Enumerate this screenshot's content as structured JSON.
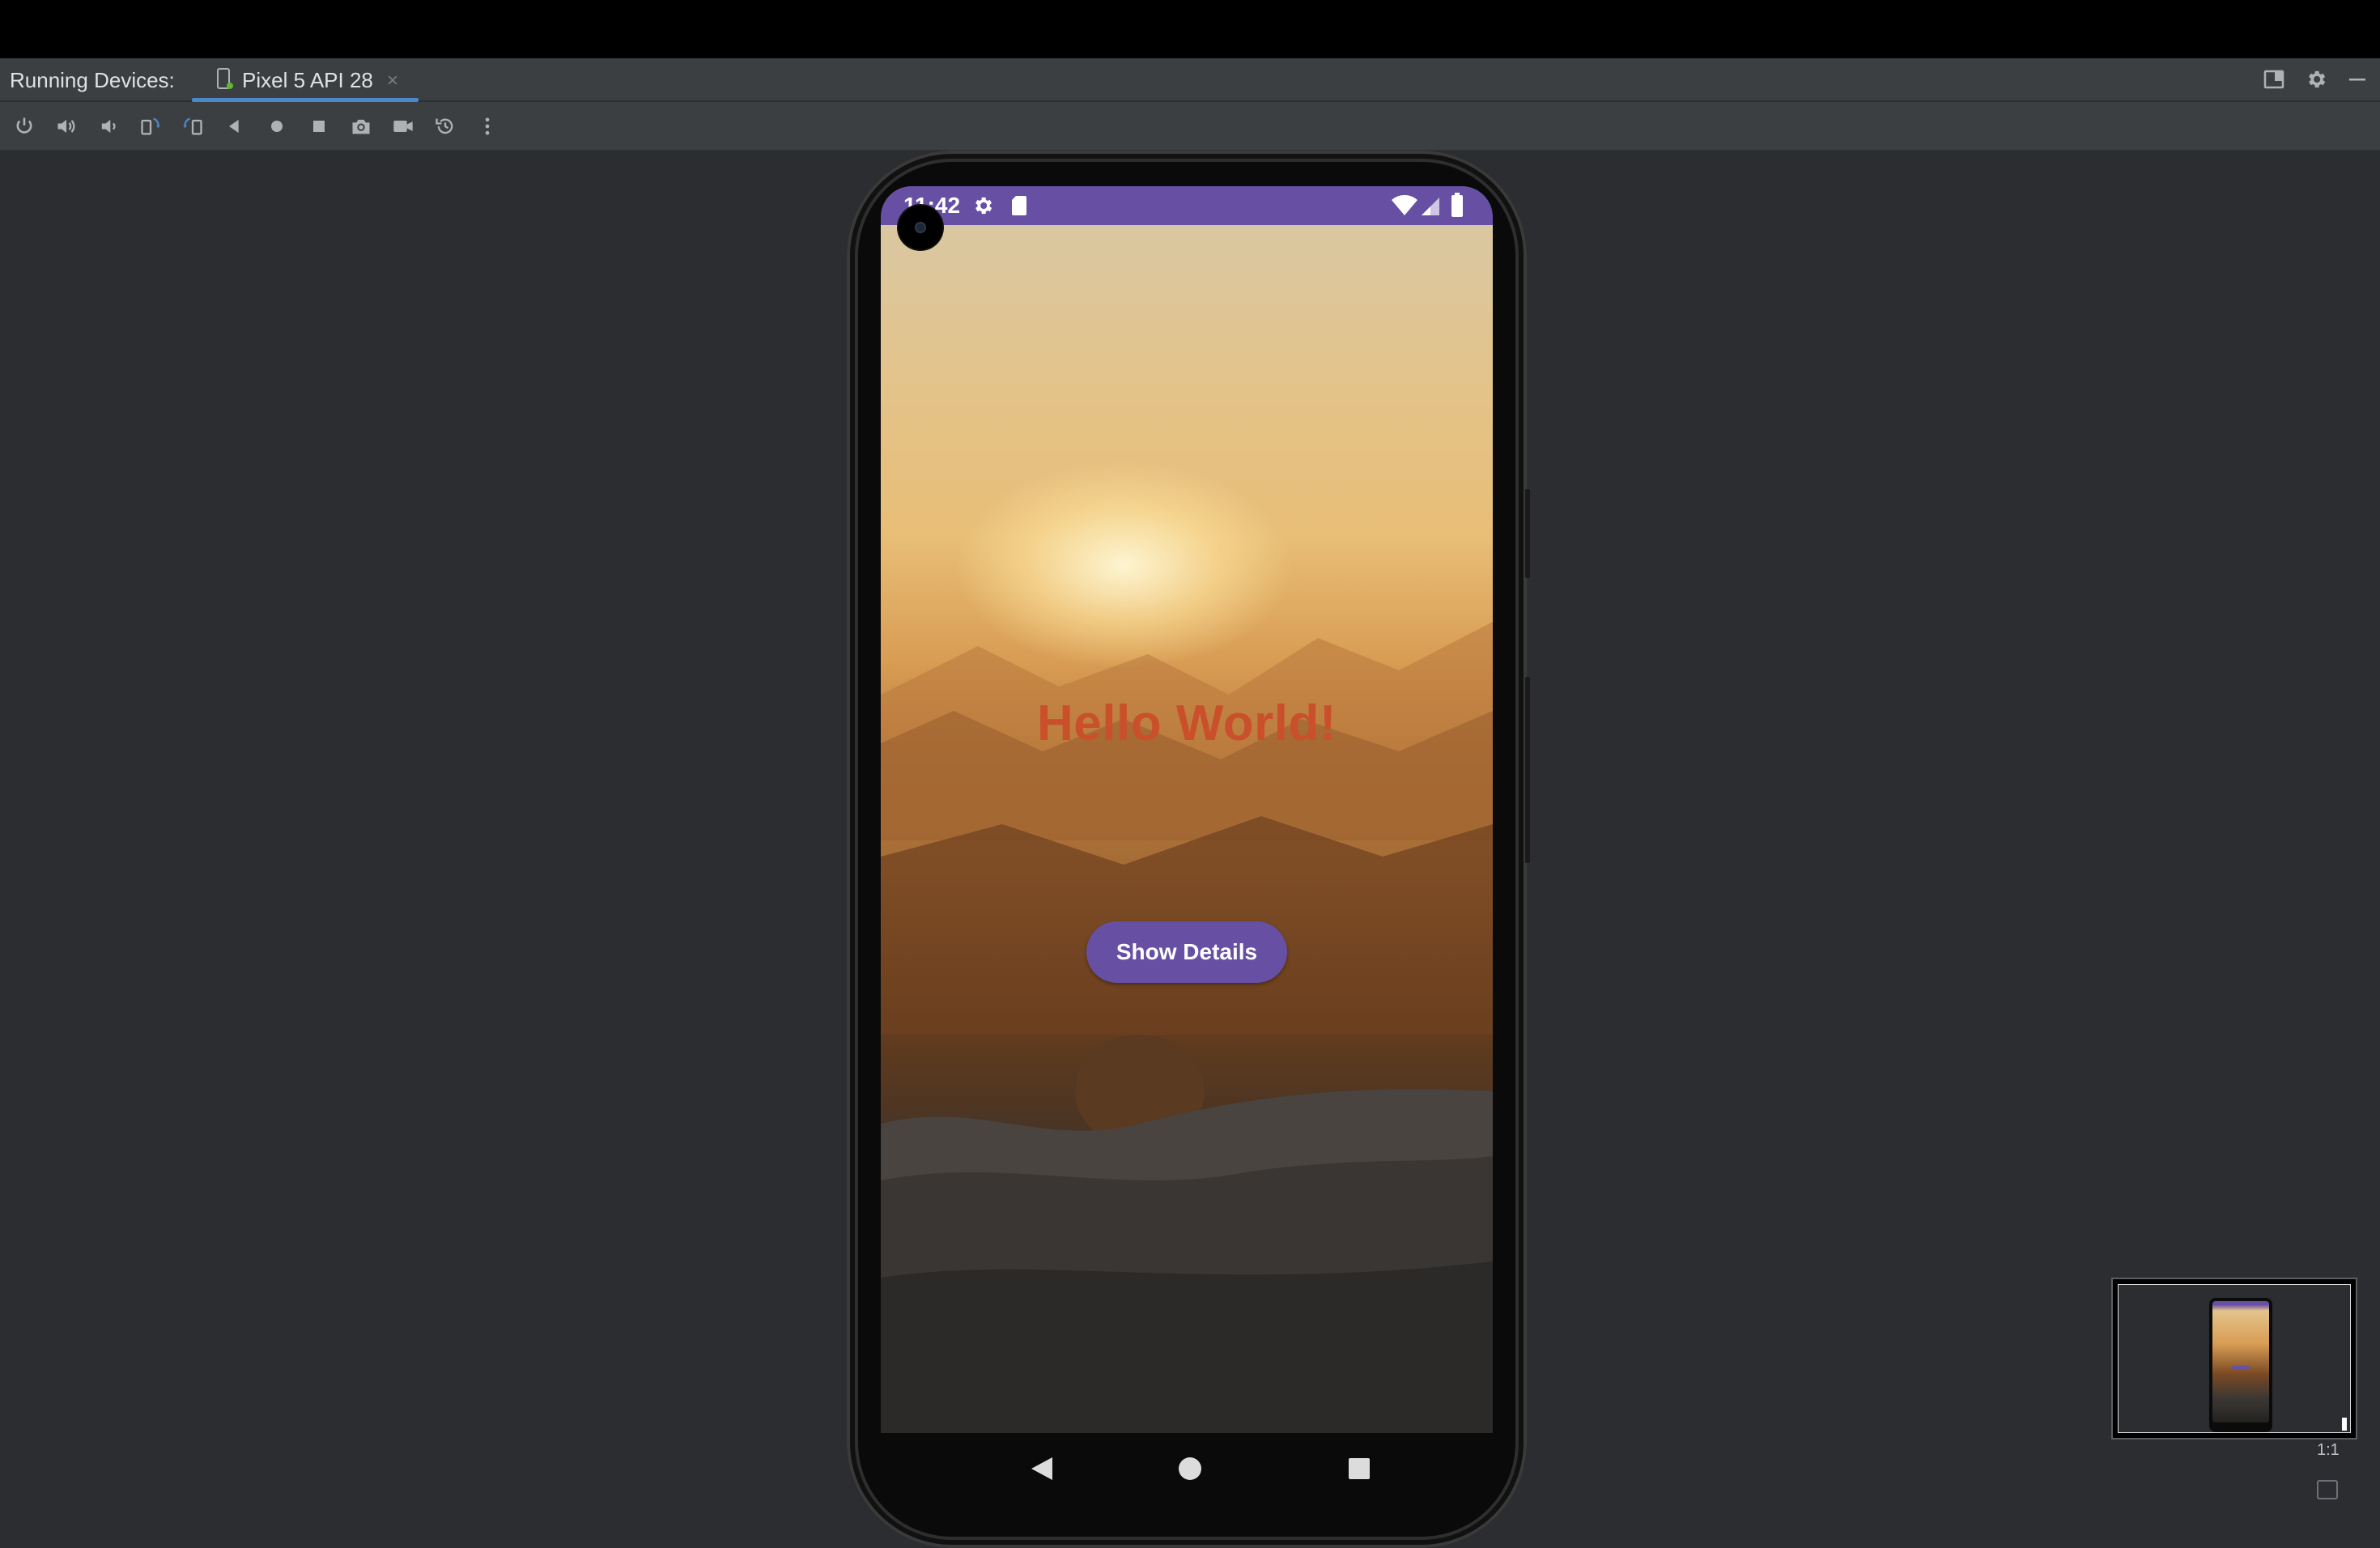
{
  "window": {
    "panel_label": "Running Devices:",
    "tab": {
      "label": "Pixel 5 API 28",
      "close": "×",
      "icon": "device-icon"
    },
    "right_icons": [
      "layout-icon",
      "gear-icon",
      "minimize-icon"
    ]
  },
  "toolbar": {
    "buttons": [
      {
        "name": "power-icon"
      },
      {
        "name": "volume-up-icon"
      },
      {
        "name": "volume-down-icon"
      },
      {
        "name": "rotate-left-icon"
      },
      {
        "name": "rotate-right-icon"
      },
      {
        "name": "back-icon"
      },
      {
        "name": "home-icon"
      },
      {
        "name": "overview-icon"
      },
      {
        "name": "screenshot-icon"
      },
      {
        "name": "record-icon"
      },
      {
        "name": "reset-icon"
      },
      {
        "name": "more-icon"
      }
    ]
  },
  "device": {
    "status_bar": {
      "time": "11:42",
      "color": "#6750a4"
    },
    "app": {
      "hello_text": "Hello World!",
      "hello_color": "#c9502a",
      "button_label": "Show Details",
      "button_color": "#6750a4"
    },
    "nav_bar": [
      "back",
      "home",
      "recents"
    ]
  },
  "minimap": {
    "ratio_label": "1:1"
  }
}
